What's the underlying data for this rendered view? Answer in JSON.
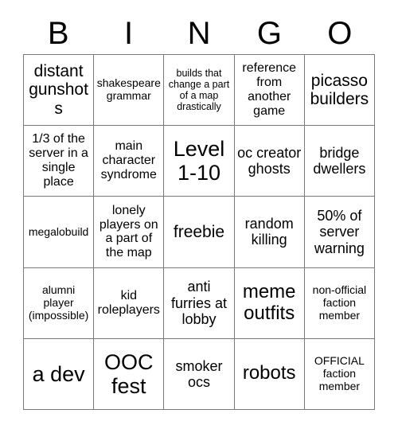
{
  "header": {
    "letters": [
      "B",
      "I",
      "N",
      "G",
      "O"
    ]
  },
  "grid": {
    "columns": 5,
    "rows": 5,
    "border_color": "#7a7a7a",
    "background_color": "#ffffff",
    "text_color": "#000000",
    "cells": [
      {
        "text": "distant gunshots",
        "size": "l"
      },
      {
        "text": "shakespeare grammar",
        "size": "xs"
      },
      {
        "text": "builds that change a part of a map drastically",
        "size": "xxs"
      },
      {
        "text": "reference from another game",
        "size": "s"
      },
      {
        "text": "picasso builders",
        "size": "l"
      },
      {
        "text": "1/3 of the server in a single place",
        "size": "s"
      },
      {
        "text": "main character syndrome",
        "size": "s"
      },
      {
        "text": "Level 1-10",
        "size": "xxl"
      },
      {
        "text": "oc creator ghosts",
        "size": "m"
      },
      {
        "text": "bridge dwellers",
        "size": "m"
      },
      {
        "text": "megalobuild",
        "size": "xs"
      },
      {
        "text": "lonely players on a part of the map",
        "size": "s"
      },
      {
        "text": "freebie",
        "size": "l"
      },
      {
        "text": "random killing",
        "size": "m"
      },
      {
        "text": "50% of server warning",
        "size": "m"
      },
      {
        "text": "alumni player (impossible)",
        "size": "xs"
      },
      {
        "text": "kid roleplayers",
        "size": "s"
      },
      {
        "text": "anti furries at lobby",
        "size": "m"
      },
      {
        "text": "meme outfits",
        "size": "xl"
      },
      {
        "text": "non-official faction member",
        "size": "xs"
      },
      {
        "text": "a dev",
        "size": "xxl"
      },
      {
        "text": "OOC fest",
        "size": "xxl"
      },
      {
        "text": "smoker ocs",
        "size": "m"
      },
      {
        "text": "robots",
        "size": "xl"
      },
      {
        "text": "OFFICIAL faction member",
        "size": "xs"
      }
    ]
  }
}
